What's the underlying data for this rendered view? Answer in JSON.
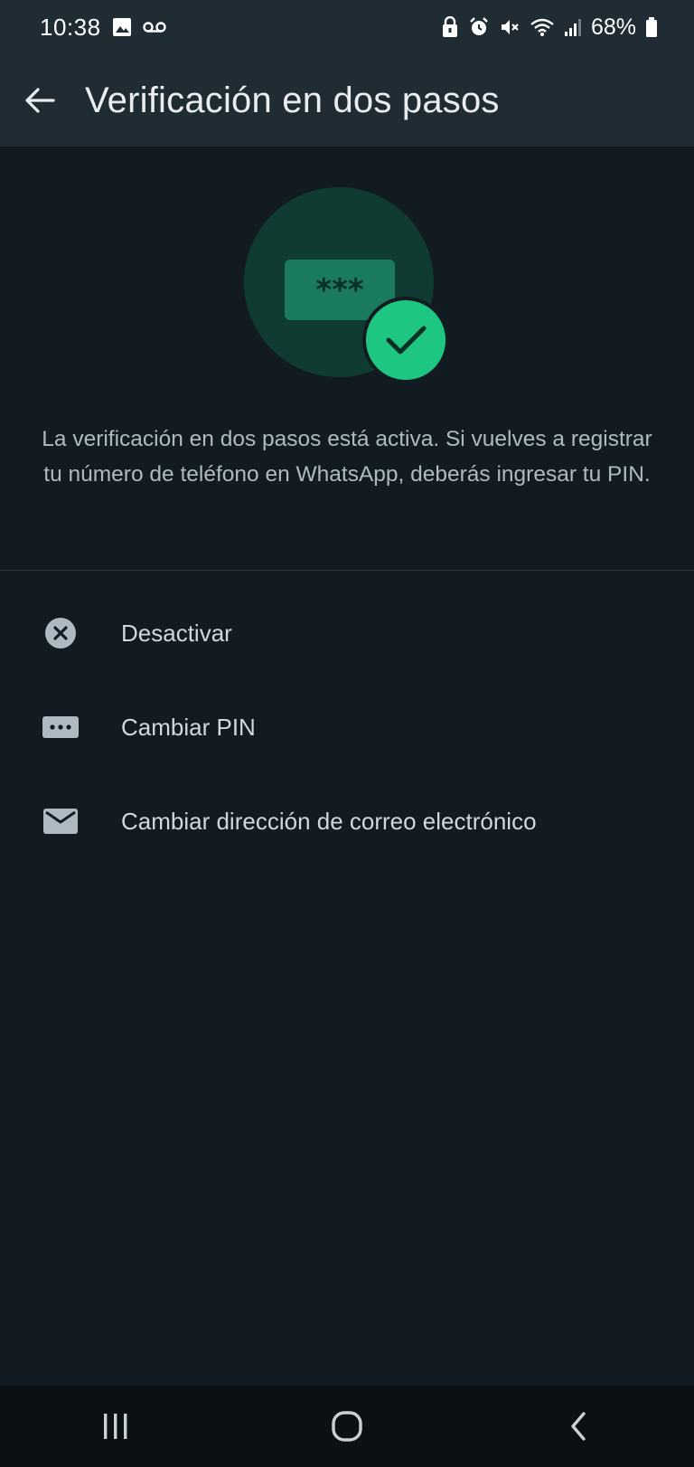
{
  "status_bar": {
    "time": "10:38",
    "battery": "68%",
    "left_icons": [
      "gallery-icon",
      "voicemail-icon"
    ],
    "right_icons": [
      "lock-icon",
      "alarm-icon",
      "mute-icon",
      "wifi-icon",
      "signal-icon",
      "battery-icon"
    ]
  },
  "app_bar": {
    "back_icon": "arrow-left-icon",
    "title": "Verificación en dos pasos"
  },
  "hero": {
    "icon": "pin-verified-icon",
    "pin_mask": "***"
  },
  "description": "La verificación en dos pasos está activa. Si vuelves a registrar tu número de teléfono en WhatsApp, deberás ingresar tu PIN.",
  "menu": {
    "items": [
      {
        "label": "Desactivar",
        "icon": "close-circle-icon"
      },
      {
        "label": "Cambiar PIN",
        "icon": "pin-dots-icon"
      },
      {
        "label": "Cambiar dirección de correo electrónico",
        "icon": "mail-icon"
      }
    ]
  },
  "nav_bar": {
    "buttons": [
      "recents-icon",
      "home-icon",
      "back-icon"
    ]
  },
  "colors": {
    "background": "#121b22",
    "header": "#1f2c34",
    "accent": "#25d366",
    "hero_circle": "#103b33",
    "text_primary": "#e9edef",
    "text_secondary": "#aebac1",
    "icon": "#aebac1"
  }
}
